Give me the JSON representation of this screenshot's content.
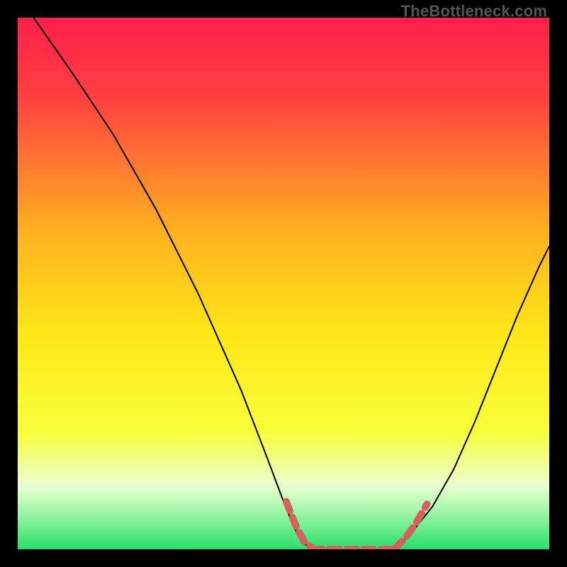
{
  "watermark": "TheBottleneck.com",
  "chart_data": {
    "type": "line",
    "title": "",
    "xlabel": "",
    "ylabel": "",
    "xlim": [
      0,
      100
    ],
    "ylim": [
      0,
      100
    ],
    "grid": false,
    "legend": false,
    "gradient_stops": [
      {
        "offset": 0.0,
        "color": "#ff1f4b"
      },
      {
        "offset": 0.15,
        "color": "#ff4040"
      },
      {
        "offset": 0.4,
        "color": "#ffb020"
      },
      {
        "offset": 0.6,
        "color": "#ffe817"
      },
      {
        "offset": 0.78,
        "color": "#f7ff3a"
      },
      {
        "offset": 0.88,
        "color": "#eaffd0"
      },
      {
        "offset": 0.93,
        "color": "#9ff7a8"
      },
      {
        "offset": 1.0,
        "color": "#26e06a"
      }
    ],
    "series": [
      {
        "name": "left-curve",
        "stroke": "#000000",
        "stroke_width": 2,
        "x": [
          3,
          10,
          18,
          26,
          34,
          42,
          47,
          50,
          52,
          54,
          55
        ],
        "y": [
          100,
          90,
          78,
          64,
          48,
          30,
          17,
          9,
          4,
          1,
          0
        ]
      },
      {
        "name": "right-curve",
        "stroke": "#000000",
        "stroke_width": 2,
        "x": [
          71,
          74,
          78,
          82,
          86,
          90,
          94,
          98,
          100
        ],
        "y": [
          0,
          3,
          8,
          15,
          24,
          34,
          44,
          53,
          57
        ]
      },
      {
        "name": "red-dash-left",
        "stroke": "#d6605a",
        "stroke_width": 10,
        "dash": "14 10",
        "linecap": "round",
        "x": [
          50.5,
          52.5,
          54,
          55.5
        ],
        "y": [
          9.0,
          4.0,
          1.3,
          0.2
        ]
      },
      {
        "name": "red-flat",
        "stroke": "#d6605a",
        "stroke_width": 10,
        "dash": "14 10",
        "linecap": "round",
        "x": [
          55.5,
          59,
          63,
          67,
          71
        ],
        "y": [
          0,
          0,
          0,
          0,
          0
        ]
      },
      {
        "name": "red-dash-right",
        "stroke": "#d6605a",
        "stroke_width": 10,
        "dash": "14 10",
        "linecap": "round",
        "x": [
          71,
          73,
          75,
          77
        ],
        "y": [
          0.2,
          2.2,
          5.0,
          8.5
        ]
      }
    ]
  }
}
